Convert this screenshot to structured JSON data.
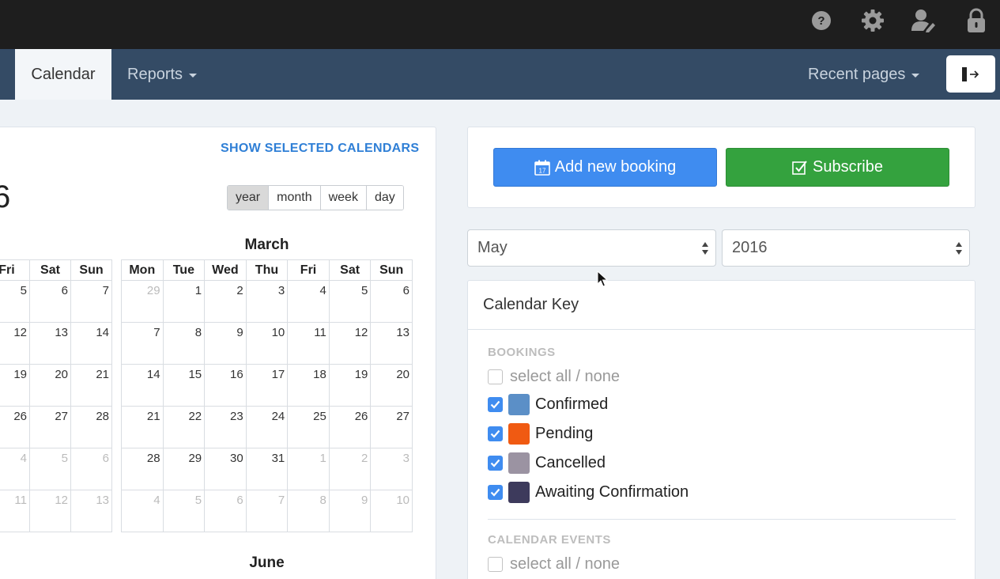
{
  "nav": {
    "calendar": "Calendar",
    "reports": "Reports",
    "recent_pages": "Recent pages"
  },
  "calendar": {
    "show_selected": "SHOW SELECTED CALENDARS",
    "year_fragment": "6",
    "views": [
      "year",
      "month",
      "week",
      "day"
    ],
    "active_view": "year",
    "weekday_headers": [
      "Mon",
      "Tue",
      "Wed",
      "Thu",
      "Fri",
      "Sat",
      "Sun"
    ],
    "partial_month": {
      "headers": [
        "Fri",
        "Sat",
        "Sun"
      ],
      "rows": [
        [
          "5",
          "6",
          "7"
        ],
        [
          "12",
          "13",
          "14"
        ],
        [
          "19",
          "20",
          "21"
        ],
        [
          "26",
          "27",
          "28"
        ],
        [
          "4",
          "5",
          "6"
        ],
        [
          "11",
          "12",
          "13"
        ]
      ],
      "muted_rows": [
        4,
        5
      ]
    },
    "march": {
      "title": "March",
      "rows": [
        [
          "29",
          "1",
          "2",
          "3",
          "4",
          "5",
          "6"
        ],
        [
          "7",
          "8",
          "9",
          "10",
          "11",
          "12",
          "13"
        ],
        [
          "14",
          "15",
          "16",
          "17",
          "18",
          "19",
          "20"
        ],
        [
          "21",
          "22",
          "23",
          "24",
          "25",
          "26",
          "27"
        ],
        [
          "28",
          "29",
          "30",
          "31",
          "1",
          "2",
          "3"
        ],
        [
          "4",
          "5",
          "6",
          "7",
          "8",
          "9",
          "10"
        ]
      ],
      "muted": [
        [
          0,
          0
        ],
        [
          4,
          4
        ],
        [
          4,
          5
        ],
        [
          4,
          6
        ],
        [
          5,
          0
        ],
        [
          5,
          1
        ],
        [
          5,
          2
        ],
        [
          5,
          3
        ],
        [
          5,
          4
        ],
        [
          5,
          5
        ],
        [
          5,
          6
        ]
      ]
    },
    "next_month_title": "June"
  },
  "actions": {
    "add_booking": "Add new booking",
    "subscribe": "Subscribe",
    "blue": "#3f8cf0",
    "green": "#34a23e"
  },
  "filters": {
    "month": "May",
    "year": "2016"
  },
  "key": {
    "title": "Calendar Key",
    "bookings_label": "BOOKINGS",
    "select_all": "select all / none",
    "items": [
      {
        "label": "Confirmed",
        "color": "#5b8fc7"
      },
      {
        "label": "Pending",
        "color": "#f05a12"
      },
      {
        "label": "Cancelled",
        "color": "#9b93a2"
      },
      {
        "label": "Awaiting Confirmation",
        "color": "#3d3a5c"
      }
    ],
    "events_label": "CALENDAR EVENTS",
    "events_select_all": "select all / none"
  }
}
